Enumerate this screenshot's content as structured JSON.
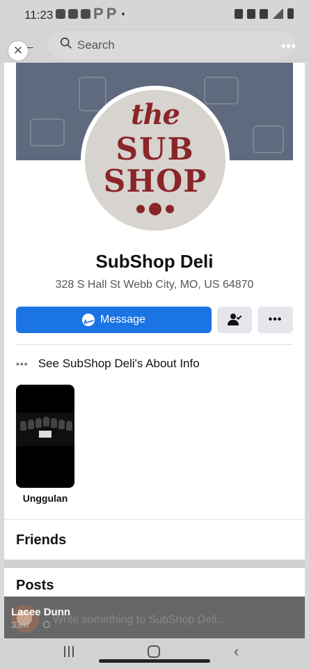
{
  "status_bar": {
    "time": "11:23",
    "notification_letters": [
      "P",
      "P"
    ]
  },
  "header": {
    "search_placeholder": "Search",
    "more_label": "•••"
  },
  "page": {
    "cover_color": "#606a7e",
    "logo_lines": [
      "the",
      "SUB",
      "SHOP"
    ],
    "name": "SubShop Deli",
    "address": "328 S Hall St Webb City, MO, US 64870"
  },
  "actions": {
    "message_label": "Message",
    "more_label": "•••",
    "accent_color": "#1b74e4"
  },
  "about": {
    "text": "See SubShop Deli's About Info"
  },
  "featured": {
    "label": "Unggulan"
  },
  "sections": {
    "friends": "Friends",
    "posts": "Posts"
  },
  "comment_overlay": {
    "name": "Lacee Dunn",
    "time": "33m",
    "placeholder": "Write something to SubShop Deli..."
  },
  "icons": [
    "close-icon",
    "search-icon",
    "messenger-icon",
    "friend-check-icon",
    "more-icon",
    "globe-icon"
  ]
}
